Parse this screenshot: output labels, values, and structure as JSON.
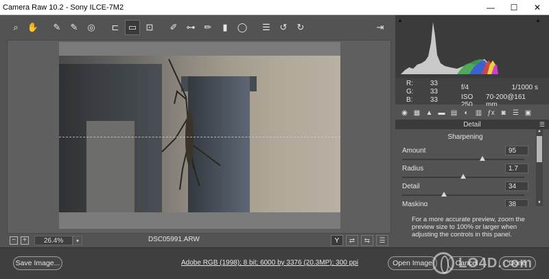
{
  "window": {
    "title": "Camera Raw 10.2  -  Sony ILCE-7M2",
    "minimize": "—",
    "maximize": "☐",
    "close": "✕"
  },
  "toolbar": {
    "tools": [
      {
        "name": "zoom-tool-icon",
        "glyph": "⌕"
      },
      {
        "name": "hand-tool-icon",
        "glyph": "✋"
      },
      {
        "name": "white-balance-tool-icon",
        "glyph": "✎"
      },
      {
        "name": "color-sampler-tool-icon",
        "glyph": "✎"
      },
      {
        "name": "targeted-adjustment-tool-icon",
        "glyph": "◎"
      },
      {
        "name": "crop-tool-icon",
        "glyph": "⊏"
      },
      {
        "name": "straighten-tool-icon",
        "glyph": "▭"
      },
      {
        "name": "transform-tool-icon",
        "glyph": "⊡"
      },
      {
        "name": "spot-removal-tool-icon",
        "glyph": "✐"
      },
      {
        "name": "red-eye-removal-icon",
        "glyph": "⊶"
      },
      {
        "name": "adjustment-brush-icon",
        "glyph": "✏"
      },
      {
        "name": "graduated-filter-icon",
        "glyph": "▮"
      },
      {
        "name": "radial-filter-icon",
        "glyph": "◯"
      },
      {
        "name": "preferences-icon",
        "glyph": "☰"
      },
      {
        "name": "rotate-left-icon",
        "glyph": "↺"
      },
      {
        "name": "rotate-right-icon",
        "glyph": "↻"
      }
    ],
    "active_tool": "straighten-tool-icon",
    "exit_icon": "⇥"
  },
  "status": {
    "zoom_minus": "−",
    "zoom_plus": "+",
    "zoom_value": "26.4%",
    "zoom_dropdown": "▾",
    "filename": "DSC05991.ARW",
    "view_y": "Y",
    "view_icons": [
      "⇄",
      "⇆",
      "☰"
    ]
  },
  "histogram": {
    "clip_shadow": "▲",
    "clip_highlight": "▲"
  },
  "readout": {
    "r_label": "R:",
    "r_value": "33",
    "g_label": "G:",
    "g_value": "33",
    "b_label": "B:",
    "b_value": "33",
    "aperture": "f/4",
    "shutter": "1/1000 s",
    "iso": "ISO 250",
    "lens": "70-200@161 mm"
  },
  "panel_tabs": [
    "◉",
    "▦",
    "▲",
    "▬",
    "▤",
    "◐",
    "▥",
    "ƒx",
    "◙",
    "☰",
    "▣"
  ],
  "panel": {
    "header": "Detail",
    "menu_icon": "☰",
    "section": "Sharpening",
    "sliders": [
      {
        "label": "Amount",
        "value": "95",
        "level": 0.66
      },
      {
        "label": "Radius",
        "value": "1.7",
        "level": 0.5
      },
      {
        "label": "Detail",
        "value": "34",
        "level": 0.34
      },
      {
        "label": "Masking",
        "value": "38",
        "level": 0.38
      }
    ],
    "note": "For a more accurate preview, zoom the preview size to 100% or larger when adjusting the controls in this panel."
  },
  "footer": {
    "save_label": "Save Image...",
    "workflow": "Adobe RGB (1998); 8 bit; 6000 by 3376 (20.3MP); 300 ppi",
    "open_label": "Open Image",
    "cancel_label": "Cancel",
    "done_label": "Done"
  },
  "watermark": "LO4D.com"
}
